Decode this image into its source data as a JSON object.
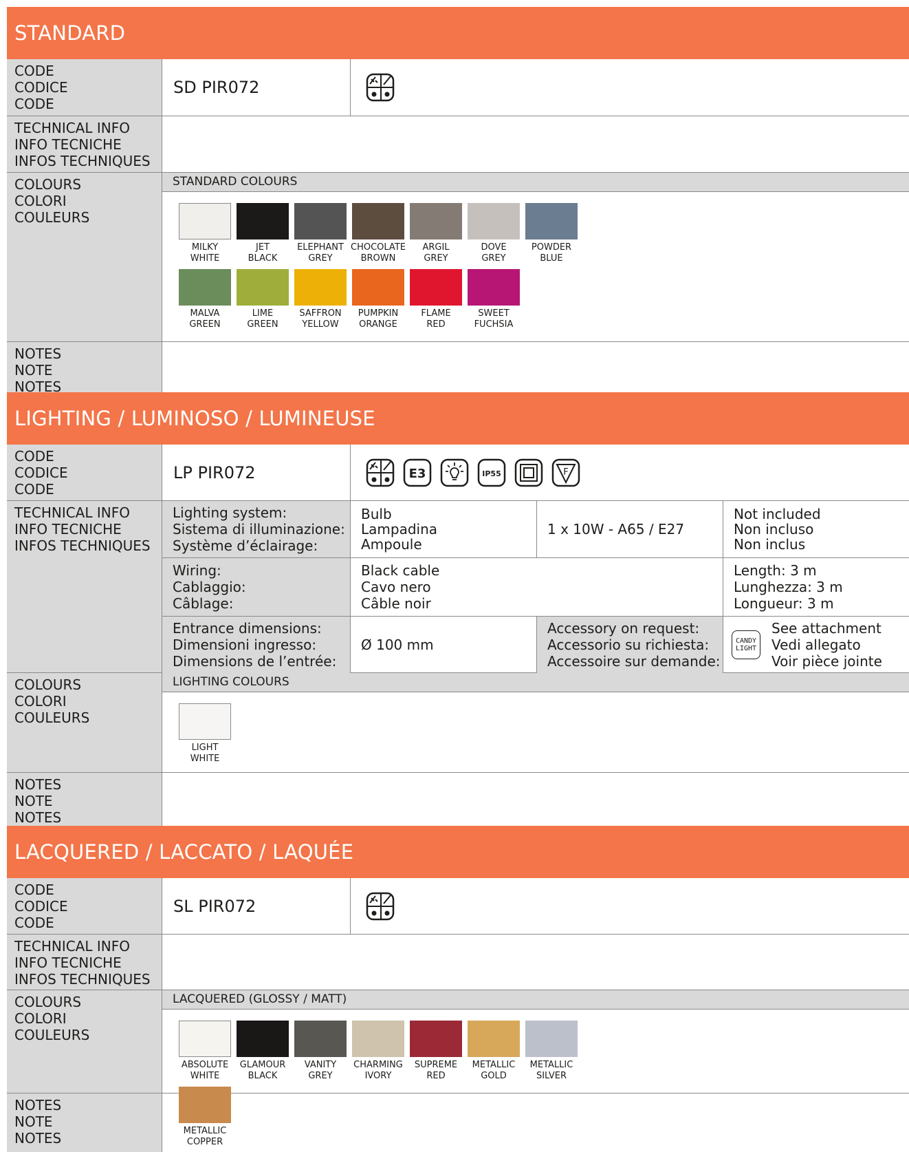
{
  "labels": {
    "code": [
      "CODE",
      "CODICE",
      "CODE"
    ],
    "tech": [
      "TECHNICAL INFO",
      "INFO TECNICHE",
      "INFOS TECHNIQUES"
    ],
    "colours": [
      "COLOURS",
      "COLORI",
      "COULEURS"
    ],
    "notes": [
      "NOTES",
      "NOTE",
      "NOTES"
    ]
  },
  "standard": {
    "title": "STANDARD",
    "code": "SD PIR072",
    "colours_header": "STANDARD COLOURS",
    "swatches": [
      {
        "label": [
          "MILKY",
          "WHITE"
        ],
        "color": "#f1efec"
      },
      {
        "label": [
          "JET",
          "BLACK"
        ],
        "color": "#1b1a18"
      },
      {
        "label": [
          "ELEPHANT",
          "GREY"
        ],
        "color": "#545454"
      },
      {
        "label": [
          "CHOCOLATE",
          "BROWN"
        ],
        "color": "#5d4d3f"
      },
      {
        "label": [
          "ARGIL",
          "GREY"
        ],
        "color": "#847b74"
      },
      {
        "label": [
          "DOVE",
          "GREY"
        ],
        "color": "#c6c0bc"
      },
      {
        "label": [
          "POWDER",
          "BLUE"
        ],
        "color": "#6a7d91"
      },
      {
        "label": [
          "MALVA",
          "GREEN"
        ],
        "color": "#6b8c5b"
      },
      {
        "label": [
          "LIME",
          "GREEN"
        ],
        "color": "#9fae3a"
      },
      {
        "label": [
          "SAFFRON",
          "YELLOW"
        ],
        "color": "#edb007"
      },
      {
        "label": [
          "PUMPKIN",
          "ORANGE"
        ],
        "color": "#e8661e"
      },
      {
        "label": [
          "FLAME",
          "RED"
        ],
        "color": "#e0162f"
      },
      {
        "label": [
          "SWEET",
          "FUCHSIA"
        ],
        "color": "#b71675"
      }
    ]
  },
  "lighting": {
    "title": "LIGHTING / LUMINOSO / LUMINEUSE",
    "code": "LP PIR072",
    "icons": [
      "indoor-outdoor-icon",
      "energy-class-icon",
      "bulb-icon",
      "ip55-icon",
      "double-insulation-icon",
      "f-mark-icon"
    ],
    "energy_text": "E3",
    "ip_text": "IP55",
    "f_text": "F",
    "tech": {
      "lighting_system": [
        "Lighting system:",
        "Sistema di illuminazione:",
        "Système d’éclairage:"
      ],
      "bulb": [
        "Bulb",
        "Lampadina",
        "Ampoule"
      ],
      "bulb_spec": "1 x 10W - A65 / E27",
      "bulb_included": [
        "Not included",
        "Non incluso",
        "Non inclus"
      ],
      "wiring": [
        "Wiring:",
        "Cablaggio:",
        "Câblage:"
      ],
      "cable": [
        "Black cable",
        "Cavo nero",
        "Câble noir"
      ],
      "length": [
        "Length: 3 m",
        "Lunghezza: 3 m",
        "Longueur: 3 m"
      ],
      "entrance": [
        "Entrance dimensions:",
        "Dimensioni ingresso:",
        "Dimensions de l’entrée:"
      ],
      "diameter": "Ø 100 mm",
      "accessory": [
        "Accessory on request:",
        "Accessorio su richiesta:",
        "Accessoire sur demande:"
      ],
      "candy_logo": [
        "CANDY",
        "LIGHT"
      ],
      "attachment": [
        "See attachment",
        "Vedi allegato",
        "Voir pièce jointe"
      ]
    },
    "colours_header": "LIGHTING COLOURS",
    "swatches": [
      {
        "label": [
          "LIGHT",
          "WHITE"
        ],
        "color": "#f6f5f4"
      }
    ]
  },
  "lacquered": {
    "title": "LACQUERED / LACCATO / LAQUÉE",
    "code": "SL PIR072",
    "colours_header": "LACQUERED (GLOSSY / MATT)",
    "swatches": [
      {
        "label": [
          "ABSOLUTE",
          "WHITE"
        ],
        "color": "#f5f4ef"
      },
      {
        "label": [
          "GLAMOUR",
          "BLACK"
        ],
        "color": "#1a1817"
      },
      {
        "label": [
          "VANITY",
          "GREY"
        ],
        "color": "#585752"
      },
      {
        "label": [
          "CHARMING",
          "IVORY"
        ],
        "color": "#cfc3ad"
      },
      {
        "label": [
          "SUPREME",
          "RED"
        ],
        "color": "#9b2a36"
      },
      {
        "label": [
          "METALLIC",
          "GOLD"
        ],
        "color": "#d8a85a"
      },
      {
        "label": [
          "METALLIC",
          "SILVER"
        ],
        "color": "#bcc0cb"
      },
      {
        "label": [
          "METALLIC",
          "COPPER"
        ],
        "color": "#c98a4d"
      }
    ]
  },
  "colors": {
    "header_orange": "#f37549",
    "label_gray": "#d9d9d9"
  }
}
